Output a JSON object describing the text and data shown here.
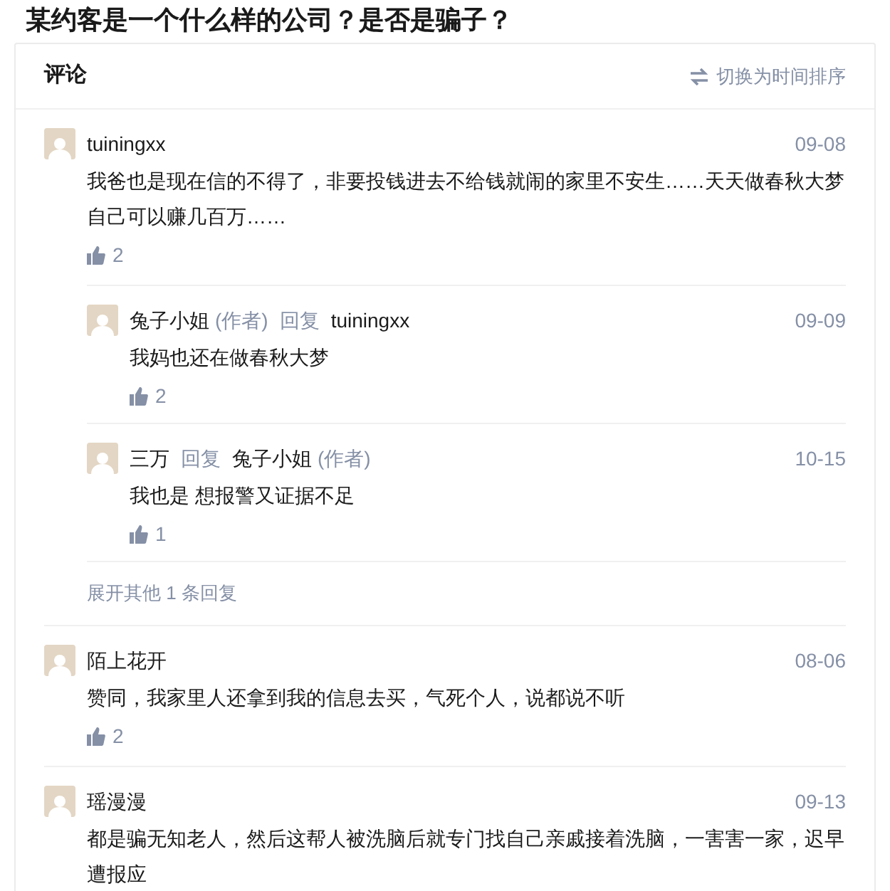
{
  "page_title": "某约客是一个什么样的公司？是否是骗子？",
  "comments_header": {
    "title": "评论",
    "sort_toggle": "切换为时间排序"
  },
  "comments": [
    {
      "user": "tuiningxx",
      "date": "09-08",
      "text": "我爸也是现在信的不得了，非要投钱进去不给钱就闹的家里不安生……天天做春秋大梦自己可以赚几百万……",
      "likes": "2",
      "replies": [
        {
          "user": "兔子小姐",
          "user_tag": "(作者)",
          "reply_word": "回复",
          "reply_to": "tuiningxx",
          "date": "09-09",
          "text": "我妈也还在做春秋大梦",
          "likes": "2"
        },
        {
          "user": "三万",
          "reply_word": "回复",
          "reply_to": "兔子小姐",
          "reply_to_tag": "(作者)",
          "date": "10-15",
          "text": "我也是 想报警又证据不足",
          "likes": "1"
        }
      ],
      "more_replies": "展开其他 1 条回复"
    },
    {
      "user": "陌上花开",
      "date": "08-06",
      "text": "赞同，我家里人还拿到我的信息去买，气死个人，说都说不听",
      "likes": "2"
    },
    {
      "user": "瑶漫漫",
      "date": "09-13",
      "text": "都是骗无知老人，然后这帮人被洗脑后就专门找自己亲戚接着洗脑，一害害一家，迟早遭报应"
    }
  ]
}
